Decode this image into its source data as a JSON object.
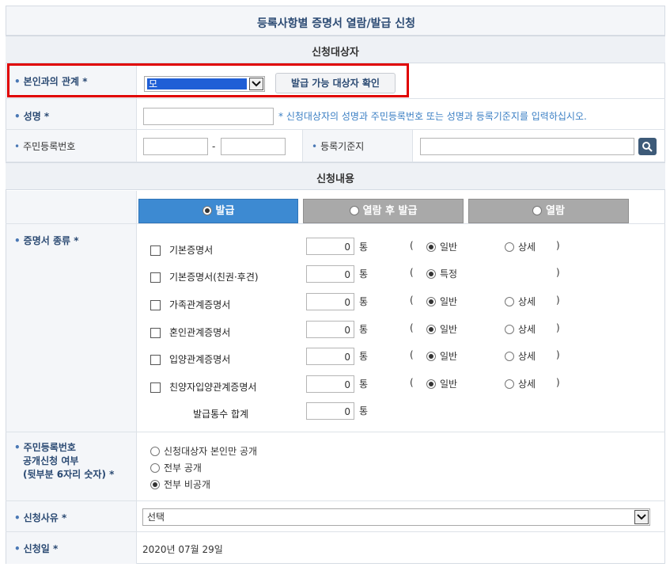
{
  "title": "등록사항별 증명서 열람/발급 신청",
  "sections": {
    "applicant": "신청대상자",
    "request": "신청내용"
  },
  "relation": {
    "label": "본인과의 관계 *",
    "value": "모",
    "confirm_button": "발급 가능 대상자 확인"
  },
  "name": {
    "label": "성명 *",
    "hint": "* 신청대상자의 성명과 주민등록번호 또는 성명과 등록기준지를 입력하십시오."
  },
  "rrn": {
    "label": "주민등록번호",
    "dash": "-"
  },
  "registry": {
    "label": "등록기준지"
  },
  "tabs": [
    {
      "label": "발급",
      "active": true
    },
    {
      "label": "열람 후 발급",
      "active": false
    },
    {
      "label": "열람",
      "active": false
    }
  ],
  "cert": {
    "label": "증명서 종류 *",
    "unit": "통",
    "open_paren": "(",
    "close_paren": ")",
    "items": [
      {
        "name": "기본증명서",
        "qty": "0",
        "opt1": "일반",
        "opt2": "상세"
      },
      {
        "name": "기본증명서(친권·후견)",
        "qty": "0",
        "opt1": "특정",
        "opt2": ""
      },
      {
        "name": "가족관계증명서",
        "qty": "0",
        "opt1": "일반",
        "opt2": "상세"
      },
      {
        "name": "혼인관계증명서",
        "qty": "0",
        "opt1": "일반",
        "opt2": "상세"
      },
      {
        "name": "입양관계증명서",
        "qty": "0",
        "opt1": "일반",
        "opt2": "상세"
      },
      {
        "name": "친양자입양관계증명서",
        "qty": "0",
        "opt1": "일반",
        "opt2": "상세"
      }
    ],
    "total_label": "발급통수 합계",
    "total_qty": "0"
  },
  "disclosure": {
    "label_line1": "주민등록번호",
    "label_line2": "공개신청 여부",
    "label_line3": "(뒷부분 6자리 숫자) *",
    "options": [
      "신청대상자 본인만 공개",
      "전부 공개",
      "전부 비공개"
    ],
    "selected": 2
  },
  "reason": {
    "label": "신청사유 *",
    "value": "선택"
  },
  "date": {
    "label": "신청일 *",
    "value": "2020년 07월 29일"
  }
}
